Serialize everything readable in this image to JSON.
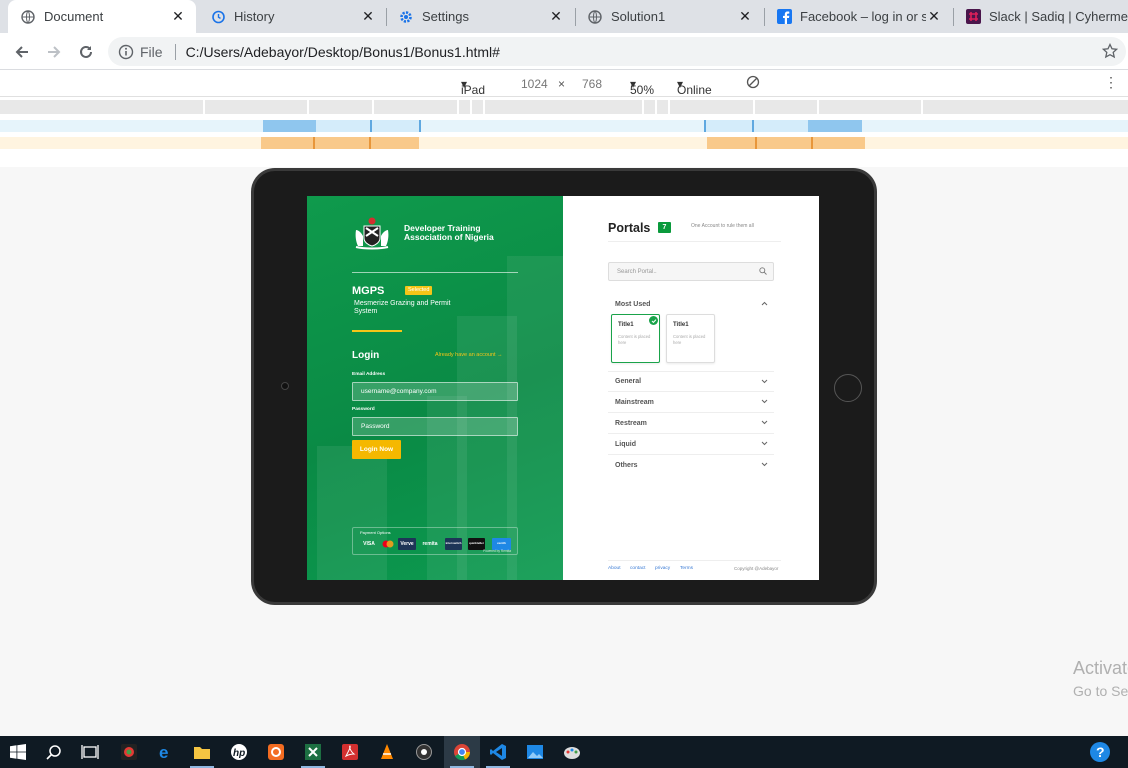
{
  "browser": {
    "tabs": [
      {
        "title": "Document",
        "icon": "globe-icon",
        "active": true
      },
      {
        "title": "History",
        "icon": "history-icon",
        "active": false
      },
      {
        "title": "Settings",
        "icon": "gear-icon",
        "active": false
      },
      {
        "title": "Solution1",
        "icon": "globe-icon",
        "active": false
      },
      {
        "title": "Facebook – log in or sig",
        "icon": "facebook-icon",
        "active": false
      },
      {
        "title": "Slack | Sadiq | Cyhermes",
        "icon": "slack-icon",
        "active": false
      }
    ],
    "close_glyph": "✕",
    "address": {
      "scheme_label": "File",
      "url": "C:/Users/Adebayor/Desktop/Bonus1/Bonus1.html#"
    }
  },
  "device_toolbar": {
    "device": "iPad",
    "width": "1024",
    "times": "×",
    "height": "768",
    "zoom": "50%",
    "throttle": "Online"
  },
  "left_panel": {
    "org_line1": "Developer Training",
    "org_line2": "Association of Nigeria",
    "product": "MGPS",
    "selected_badge": "Selected",
    "product_desc": "Mesmerize Grazing and Permit System",
    "login_heading": "Login",
    "already_link": "Already have an account  →",
    "email_label": "Email Address",
    "email_value": "username@company.com",
    "password_label": "Password",
    "password_value": "Password",
    "login_button": "Login Now",
    "payment_title": "Payment Options",
    "payment_logos": [
      "VISA",
      "mastercard",
      "Verve",
      "remita",
      "interswitch",
      "quickteller",
      "zenith"
    ],
    "payment_powered": "Powered by Remita"
  },
  "right_panel": {
    "title": "Portals",
    "count": "7",
    "tagline": "One Account to rule them all",
    "search_placeholder": "Search Portal..",
    "most_used": "Most Used",
    "cards": [
      {
        "title": "Title1",
        "body": "Content is placed here",
        "checked": true
      },
      {
        "title": "Title1",
        "body": "Content is placed here",
        "checked": false
      }
    ],
    "sections": [
      "General",
      "Mainstream",
      "Restream",
      "Liquid",
      "Others"
    ],
    "footer_links": [
      "About",
      "contact",
      "privacy",
      "Terms"
    ],
    "copyright": "Copyright @Adebayor"
  },
  "windows_watermark": {
    "line1": "Activate Windows",
    "line2": "Go to Settings to activate Windows."
  },
  "colors": {
    "brand_green": "#0f9a4c",
    "accent_gold": "#f5c518",
    "badge_green": "#0a9a3c"
  },
  "taskbar": {
    "apps": [
      "windows-start-icon",
      "search-icon",
      "task-view-icon",
      "app-icon",
      "edge-icon",
      "file-explorer-icon",
      "hp-icon",
      "office-icon",
      "excel-icon",
      "acrobat-icon",
      "vlc-icon",
      "camera-icon",
      "chrome-icon",
      "vscode-icon",
      "photos-icon",
      "paint-icon"
    ]
  }
}
